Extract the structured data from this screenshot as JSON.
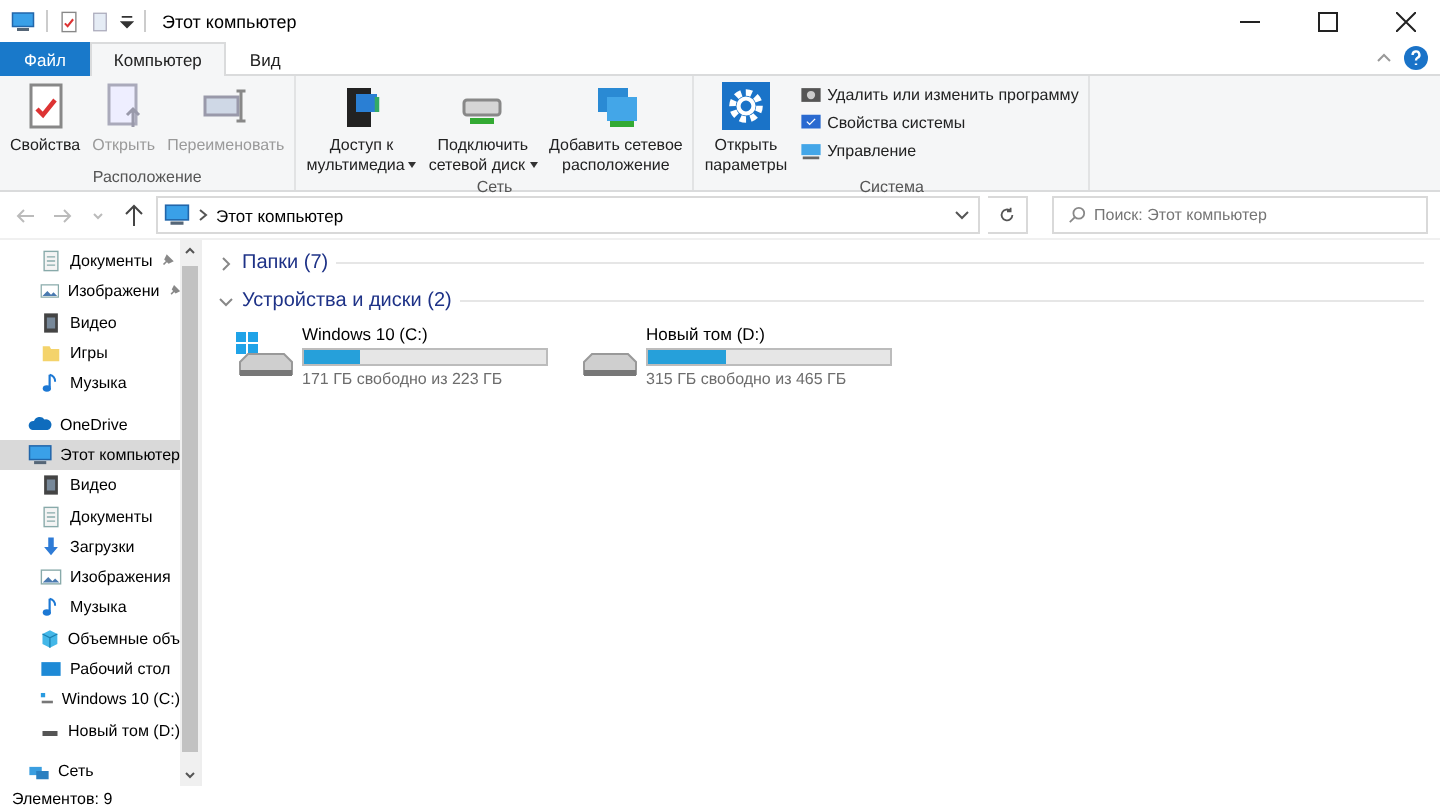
{
  "window": {
    "title": "Этот компьютер"
  },
  "tabs": [
    {
      "label": "Файл",
      "kind": "file",
      "selected": false
    },
    {
      "label": "Компьютер",
      "kind": "tab",
      "selected": true
    },
    {
      "label": "Вид",
      "kind": "tab",
      "selected": false
    }
  ],
  "ribbon": {
    "groups": [
      {
        "label": "Расположение",
        "items": [
          {
            "kind": "large",
            "label": "Свойства",
            "disabled": false,
            "dropdown": false
          },
          {
            "kind": "large",
            "label": "Открыть",
            "disabled": true,
            "dropdown": false
          },
          {
            "kind": "large",
            "label": "Переименовать",
            "disabled": true,
            "dropdown": false
          }
        ]
      },
      {
        "label": "Сеть",
        "items": [
          {
            "kind": "large",
            "label": "Доступ к\nмультимедиа",
            "disabled": false,
            "dropdown": true
          },
          {
            "kind": "large",
            "label": "Подключить\nсетевой диск",
            "disabled": false,
            "dropdown": true
          },
          {
            "kind": "large",
            "label": "Добавить сетевое\nрасположение",
            "disabled": false,
            "dropdown": false
          }
        ]
      },
      {
        "label": "Система",
        "items": [
          {
            "kind": "large",
            "label": "Открыть\nпараметры",
            "disabled": false,
            "dropdown": false
          },
          {
            "kind": "small",
            "label": "Удалить или изменить программу",
            "disabled": false
          },
          {
            "kind": "small",
            "label": "Свойства системы",
            "disabled": false
          },
          {
            "kind": "small",
            "label": "Управление",
            "disabled": false
          }
        ]
      }
    ]
  },
  "address": {
    "path": "Этот компьютер"
  },
  "search": {
    "placeholder": "Поиск: Этот компьютер"
  },
  "sidebar": {
    "quick_access": [
      {
        "label": "Документы",
        "pinned": true
      },
      {
        "label": "Изображени",
        "pinned": true
      },
      {
        "label": "Видео",
        "pinned": false
      },
      {
        "label": "Игры",
        "pinned": false
      },
      {
        "label": "Музыка",
        "pinned": false
      }
    ],
    "items": [
      {
        "label": "OneDrive",
        "selected": false
      },
      {
        "label": "Этот компьютер",
        "selected": true,
        "children": [
          {
            "label": "Видео",
            "selected": false
          },
          {
            "label": "Документы",
            "selected": false
          },
          {
            "label": "Загрузки",
            "selected": false
          },
          {
            "label": "Изображения",
            "selected": false
          },
          {
            "label": "Музыка",
            "selected": false
          },
          {
            "label": "Объемные объ",
            "selected": false
          },
          {
            "label": "Рабочий стол",
            "selected": false
          },
          {
            "label": "Windows 10 (C:)",
            "selected": false
          },
          {
            "label": "Новый том (D:)",
            "selected": false
          }
        ]
      },
      {
        "label": "Сеть",
        "selected": false
      }
    ]
  },
  "sections": [
    {
      "label": "Папки (7)",
      "expanded": false
    },
    {
      "label": "Устройства и диски (2)",
      "expanded": true,
      "drives": [
        {
          "name": "Windows 10 (C:)",
          "kind": "system",
          "level": 0.23,
          "free": "171 ГБ свободно из 223 ГБ"
        },
        {
          "name": "Новый том (D:)",
          "kind": "data",
          "level": 0.32,
          "free": "315 ГБ свободно из 465 ГБ"
        }
      ]
    }
  ],
  "status_bar": {
    "text": "Элементов: 9"
  }
}
